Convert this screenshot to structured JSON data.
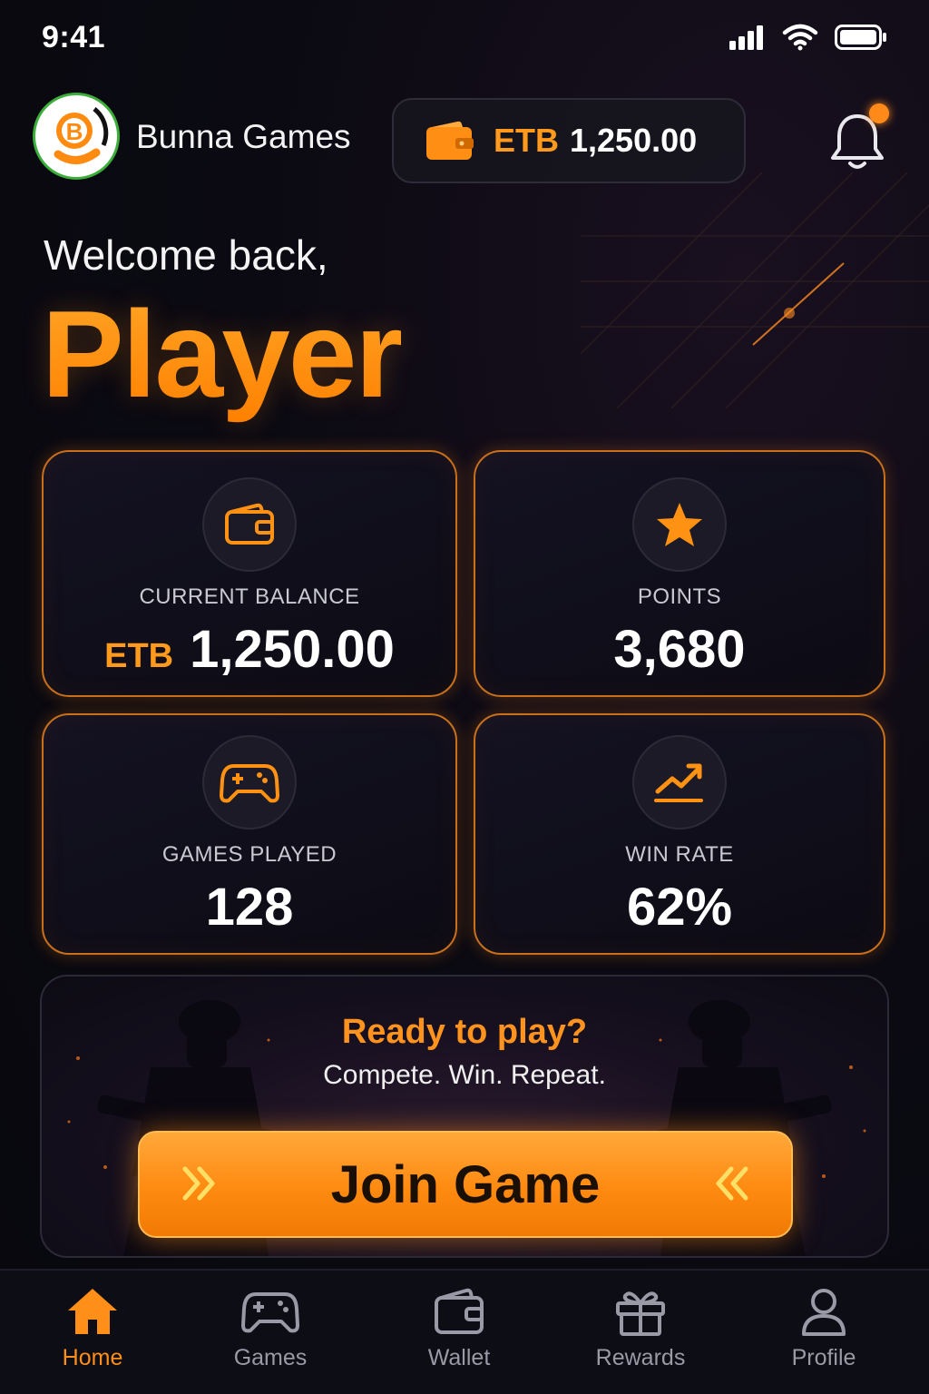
{
  "status_bar": {
    "time": "9:41"
  },
  "header": {
    "app_name": "Bunna Games",
    "balance_currency": "ETB",
    "balance_amount": "1,250.00"
  },
  "greeting": {
    "welcome": "Welcome back,",
    "name": "Player"
  },
  "stats": [
    {
      "icon": "wallet-icon",
      "label": "CURRENT BALANCE",
      "currency": "ETB",
      "value": "1,250.00"
    },
    {
      "icon": "star-icon",
      "label": "POINTS",
      "value": "3,680"
    },
    {
      "icon": "gamepad-icon",
      "label": "GAMES PLAYED",
      "value": "128"
    },
    {
      "icon": "trend-up-icon",
      "label": "WIN RATE",
      "value": "62%"
    }
  ],
  "banner": {
    "title": "Ready to play?",
    "subtitle": "Compete. Win. Repeat.",
    "button_label": "Join Game"
  },
  "nav": [
    {
      "label": "Home",
      "icon": "home-icon",
      "active": true
    },
    {
      "label": "Games",
      "icon": "gamepad-icon"
    },
    {
      "label": "Wallet",
      "icon": "wallet-icon"
    },
    {
      "label": "Rewards",
      "icon": "gift-icon"
    },
    {
      "label": "Profile",
      "icon": "user-icon"
    }
  ],
  "colors": {
    "accent": "#ff9212",
    "background": "#0b0a12",
    "card_border": "#c8701c"
  }
}
